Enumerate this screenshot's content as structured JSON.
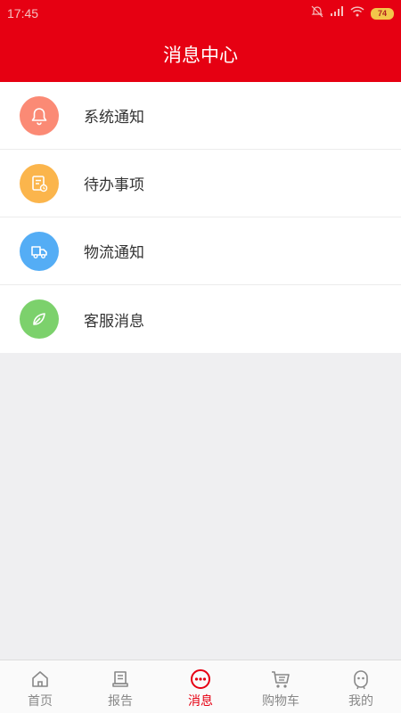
{
  "status": {
    "time": "17:45",
    "battery": "74"
  },
  "header": {
    "title": "消息中心"
  },
  "menu": {
    "items": [
      {
        "label": "系统通知",
        "icon": "bell-icon",
        "color": "#fb8a75"
      },
      {
        "label": "待办事项",
        "icon": "todo-icon",
        "color": "#fbb54c"
      },
      {
        "label": "物流通知",
        "icon": "truck-icon",
        "color": "#54adf5"
      },
      {
        "label": "客服消息",
        "icon": "leaf-icon",
        "color": "#7cd16c"
      }
    ]
  },
  "tabbar": {
    "tabs": [
      {
        "label": "首页",
        "icon": "home-icon"
      },
      {
        "label": "报告",
        "icon": "report-icon"
      },
      {
        "label": "消息",
        "icon": "message-icon",
        "active": true
      },
      {
        "label": "购物车",
        "icon": "cart-icon"
      },
      {
        "label": "我的",
        "icon": "user-icon"
      }
    ]
  },
  "colors": {
    "brand": "#e60012",
    "background": "#efeff1"
  }
}
